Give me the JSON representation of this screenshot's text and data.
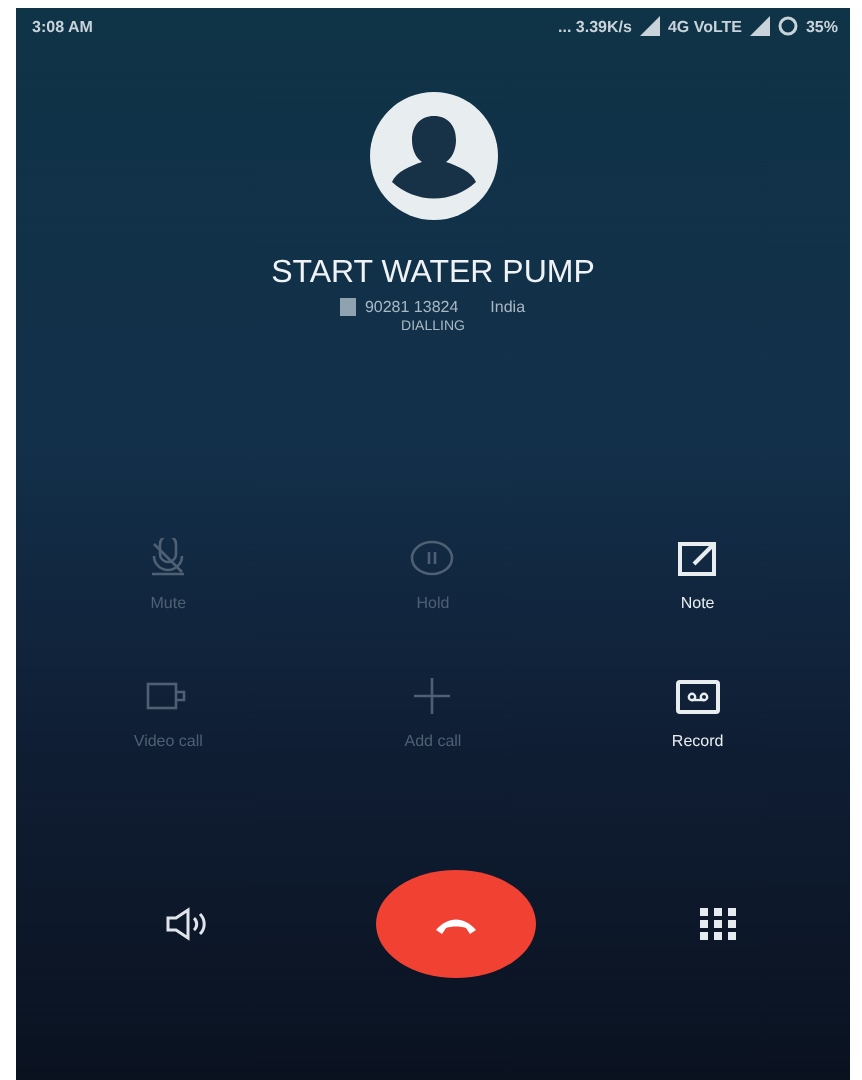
{
  "status_bar": {
    "time": "3:08 AM",
    "indicators": "... 3.39K/s",
    "network": "4G VoLTE",
    "battery": "35%"
  },
  "contact": {
    "name": "START WATER PUMP",
    "number": "90281 13824",
    "location": "India",
    "call_state": "DIALLING"
  },
  "actions": [
    {
      "kind": "mute",
      "label": "Mute",
      "disabled": true
    },
    {
      "kind": "hold",
      "label": "Hold",
      "disabled": true
    },
    {
      "kind": "note",
      "label": "Note",
      "disabled": false
    },
    {
      "kind": "video",
      "label": "Video call",
      "disabled": true
    },
    {
      "kind": "add",
      "label": "Add call",
      "disabled": true
    },
    {
      "kind": "record",
      "label": "Record",
      "disabled": false
    }
  ]
}
